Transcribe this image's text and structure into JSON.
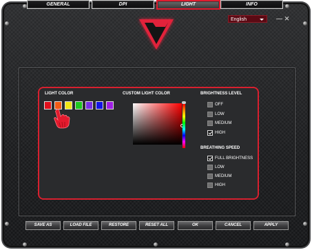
{
  "header": {
    "language": "English"
  },
  "window_controls": {
    "minimize": "—",
    "close": "✕"
  },
  "tabs": [
    {
      "label": "GENERAL"
    },
    {
      "label": "DPI"
    },
    {
      "label": "LIGHT"
    },
    {
      "label": "INFO"
    }
  ],
  "light": {
    "light_color_label": "LIGHT COLOR",
    "swatches": [
      "#e0101c",
      "#f05a14",
      "#f0e614",
      "#1ec81e",
      "#7a2ee6",
      "#1414e6",
      "#a01ee6"
    ],
    "custom_color_label": "CUSTOM LIGHT COLOR",
    "brightness_label": "BRIGHTNESS LEVEL",
    "brightness_options": [
      {
        "label": "OFF",
        "checked": false
      },
      {
        "label": "LOW",
        "checked": false
      },
      {
        "label": "MEDIUM",
        "checked": false
      },
      {
        "label": "HIGH",
        "checked": true
      }
    ],
    "breathing_label": "BREATHING SPEED",
    "breathing_options": [
      {
        "label": "FULL BRIGHTNESS",
        "checked": true
      },
      {
        "label": "LOW",
        "checked": false
      },
      {
        "label": "MEDIUM",
        "checked": false
      },
      {
        "label": "HIGH",
        "checked": false
      }
    ]
  },
  "footer": {
    "buttons": [
      "SAVE AS",
      "LOAD FILE",
      "RESTORE",
      "RESET ALL",
      "OK",
      "CANCEL",
      "APPLY"
    ]
  },
  "colors": {
    "accent": "#d8202f",
    "background": "#1f2022"
  }
}
